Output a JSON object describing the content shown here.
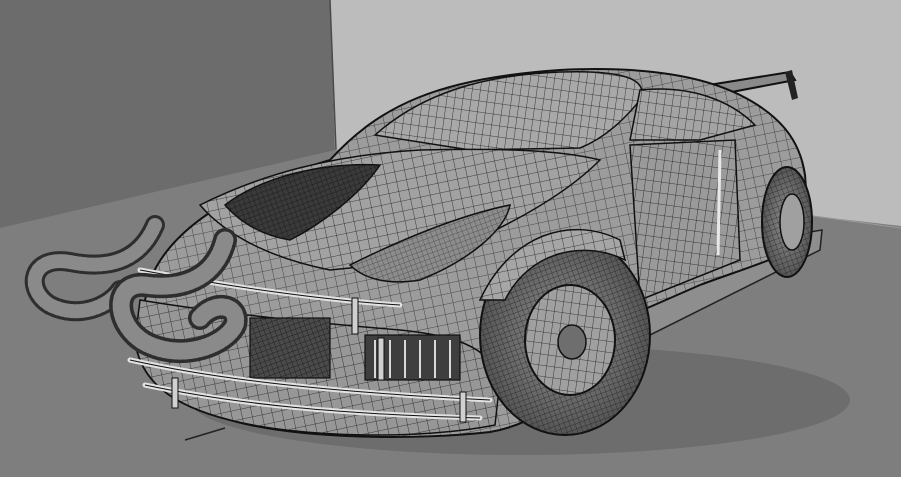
{
  "scene": {
    "subject": "wireframe-sports-car-3d-model",
    "colors": {
      "wall_left": "#6a6a6a",
      "wall_back": "#bdbdbd",
      "floor": "#7e7e7e",
      "body_fill": "#9a9a9a",
      "wire": "#1c1c1c",
      "highlight": "#e6e6e6"
    }
  }
}
